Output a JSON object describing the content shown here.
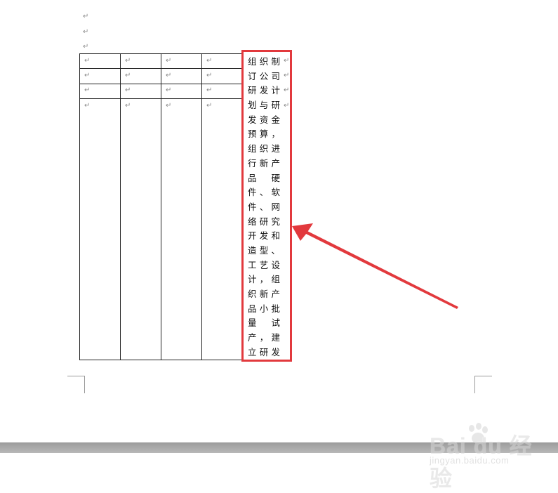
{
  "document": {
    "paragraph_mark": "↵",
    "text_lines": [
      "组织制",
      "订公司",
      "研发计",
      "划与研",
      "发资金",
      "预算，",
      "组织进",
      "行新产",
      "品　硬",
      "件、软",
      "件、网",
      "络研究",
      "开发和",
      "造型、",
      "工艺设",
      "计，组",
      "织新产",
      "品小批",
      "量　试",
      "产，建",
      "立研发"
    ]
  },
  "colors": {
    "highlight": "#e2393d",
    "table_border": "#222222",
    "status_bar": "#a8a8a8"
  },
  "watermark": {
    "logo_text": "Bai du 经验",
    "url_text": "jingyan.baidu.com"
  }
}
